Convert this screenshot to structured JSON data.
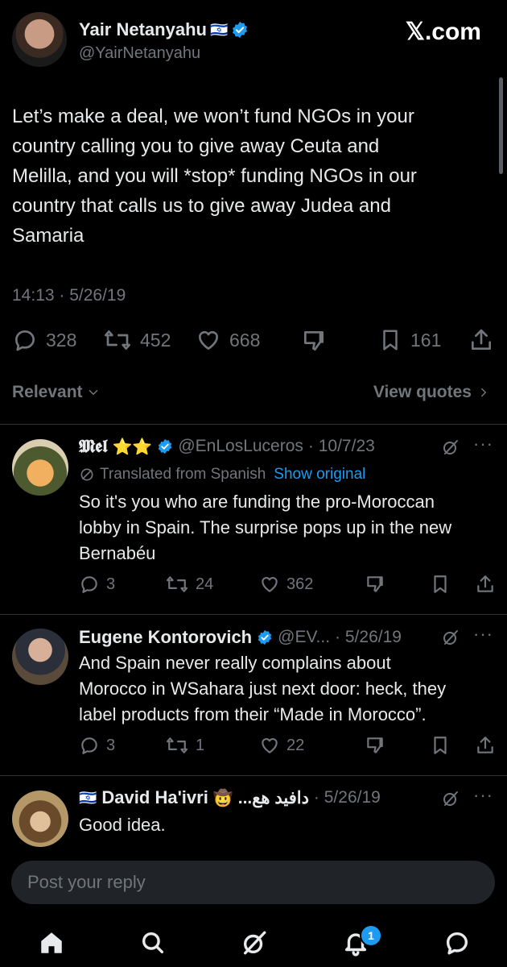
{
  "header": {
    "name": "Yair Netanyahu",
    "flag": "🇮🇱",
    "handle": "@YairNetanyahu",
    "brand": "𝕏.com"
  },
  "tweet": {
    "text_lines": [
      "Let’s make a deal, we won’t fund NGOs in your",
      "country calling you to give away Ceuta and",
      "Melilla, and you will *stop* funding NGOs in our",
      "country that calls us to give away Judea and",
      "Samaria"
    ],
    "timestamp": "14:13 · 5/26/19",
    "replies": "328",
    "reposts": "452",
    "likes": "668",
    "bookmarks": "161"
  },
  "filters": {
    "sort_label": "Relevant",
    "quotes_label": "View quotes"
  },
  "replies": [
    {
      "name": "𝕸𝖊𝖑",
      "stars": "⭐⭐",
      "handle": "@EnLosLuceros",
      "date": "· 10/7/23",
      "translated": "Translated from Spanish",
      "show_original": "Show original",
      "text_lines": [
        "So it's you who are funding the pro-Moroccan",
        "lobby in Spain. The surprise pops up in the new",
        "Bernabéu"
      ],
      "replies": "3",
      "reposts": "24",
      "likes": "362"
    },
    {
      "name": "Eugene Kontorovich",
      "handle": "@EV...",
      "date": "· 5/26/19",
      "text_lines": [
        "And  Spain never really complains about",
        "Morocco in WSahara just next door: heck, they",
        "label products from their “Made in Morocco”."
      ],
      "replies": "3",
      "reposts": "1",
      "likes": "22"
    },
    {
      "flag": "🇮🇱",
      "name": "David Ha'ivri",
      "emoji": "🤠",
      "name_arabic": "...دافيد هع",
      "date": "· 5/26/19",
      "text_lines": [
        "Good idea."
      ]
    }
  ],
  "composer": {
    "placeholder": "Post your reply"
  },
  "tabbar": {
    "notifications_badge": "1"
  },
  "colors": {
    "background": "#000000",
    "text": "#e7e9ea",
    "muted": "#71767b",
    "accent": "#1d9bf0",
    "divider": "#2f3336"
  }
}
